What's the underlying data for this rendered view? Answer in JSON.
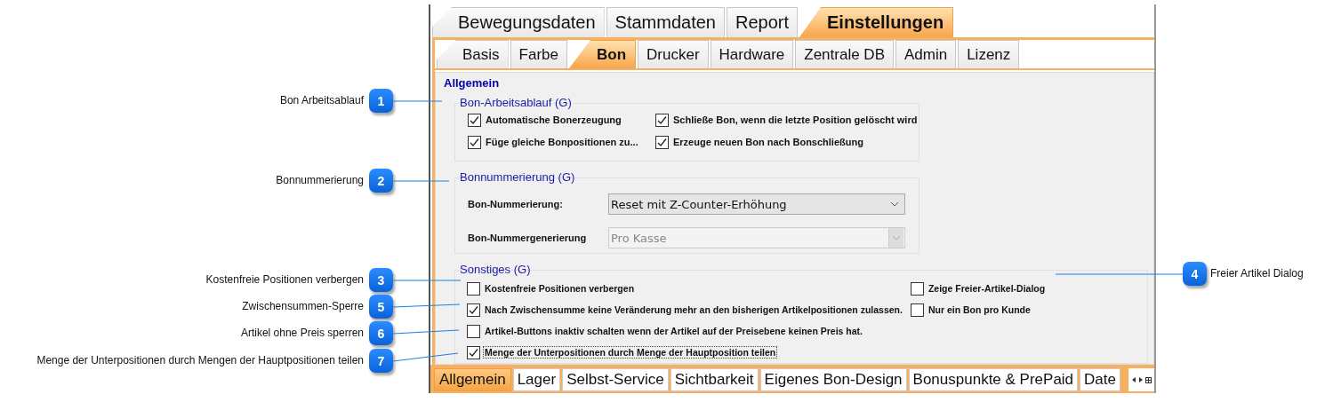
{
  "callouts": [
    {
      "number": "1",
      "label": "Bon Arbeitsablauf"
    },
    {
      "number": "2",
      "label": "Bonnummerierung"
    },
    {
      "number": "3",
      "label": "Kostenfreie Positionen verbergen"
    },
    {
      "number": "4",
      "label": "Freier Artikel Dialog"
    },
    {
      "number": "5",
      "label": "Zwischensummen-Sperre"
    },
    {
      "number": "6",
      "label": "Artikel ohne Preis sperren"
    },
    {
      "number": "7",
      "label": "Menge der Unterpositionen durch Mengen der Hauptpositionen teilen"
    }
  ],
  "main_tabs": [
    {
      "label": "Bewegungsdaten",
      "selected": false
    },
    {
      "label": "Stammdaten",
      "selected": false
    },
    {
      "label": "Report",
      "selected": false
    },
    {
      "label": "Einstellungen",
      "selected": true
    }
  ],
  "sub_tabs": [
    {
      "label": "Basis",
      "selected": false
    },
    {
      "label": "Farbe",
      "selected": false
    },
    {
      "label": "Bon",
      "selected": true
    },
    {
      "label": "Drucker",
      "selected": false
    },
    {
      "label": "Hardware",
      "selected": false
    },
    {
      "label": "Zentrale DB",
      "selected": false
    },
    {
      "label": "Admin",
      "selected": false
    },
    {
      "label": "Lizenz",
      "selected": false
    }
  ],
  "section_title": "Allgemein",
  "workflow_group": {
    "title": "Bon-Arbeitsablauf (G)",
    "checkboxes": [
      {
        "label": "Automatische Bonerzeugung",
        "checked": true
      },
      {
        "label": "Schließe Bon, wenn die letzte Position gelöscht wird",
        "checked": true
      },
      {
        "label": "Füge gleiche Bonpositionen zu...",
        "checked": true
      },
      {
        "label": "Erzeuge neuen Bon nach Bonschließung",
        "checked": true
      }
    ]
  },
  "numbering_group": {
    "title": "Bonnummerierung (G)",
    "fields": [
      {
        "label": "Bon-Nummerierung:",
        "value": "Reset mit Z-Counter-Erhöhung",
        "disabled": false
      },
      {
        "label": "Bon-Nummergenerierung",
        "value": "Pro Kasse",
        "disabled": true
      }
    ]
  },
  "misc_group": {
    "title": "Sonstiges (G)",
    "checkboxes": [
      {
        "label": "Kostenfreie Positionen verbergen",
        "checked": false,
        "focused": false
      },
      {
        "label": "Zeige Freier-Artikel-Dialog",
        "checked": false,
        "focused": false
      },
      {
        "label": "Nach Zwischensumme keine Veränderung mehr an den bisherigen Artikelpositionen zulassen.",
        "checked": true,
        "focused": false
      },
      {
        "label": "Nur ein Bon pro Kunde",
        "checked": false,
        "focused": false
      },
      {
        "label": "Artikel-Buttons inaktiv schalten wenn der Artikel auf der Preisebene keinen Preis hat.",
        "checked": false,
        "focused": false
      },
      {
        "label": "Menge der Unterpositionen durch Menge der Hauptposition teilen",
        "checked": true,
        "focused": true
      }
    ]
  },
  "bottom_tabs": [
    {
      "label": "Allgemein",
      "selected": true
    },
    {
      "label": "Lager",
      "selected": false
    },
    {
      "label": "Selbst-Service",
      "selected": false
    },
    {
      "label": "Sichtbarkeit",
      "selected": false
    },
    {
      "label": "Eigenes Bon-Design",
      "selected": false
    },
    {
      "label": "Bonuspunkte & PrePaid",
      "selected": false
    },
    {
      "label": "Date",
      "selected": false
    }
  ]
}
